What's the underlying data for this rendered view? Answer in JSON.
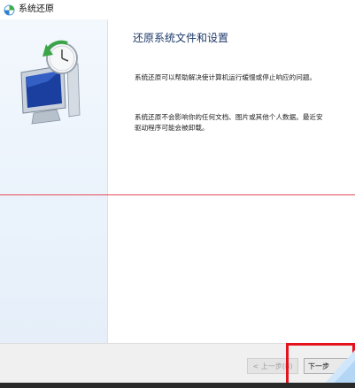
{
  "window": {
    "title": "系统还原",
    "title_icon": "system-restore-icon"
  },
  "main": {
    "heading": "还原系统文件和设置",
    "paragraph1": "系统还原可以帮助解决使计算机运行缓慢或停止响应的问题。",
    "paragraph2_lines": [
      "系统还原不会影响你的任何文档、图片或其他个人数据。最近安",
      "驱动程序可能会被卸载。"
    ]
  },
  "footer": {
    "back_label": "< 上一步(B)",
    "next_label": "下一步"
  },
  "colors": {
    "heading": "#1d3a6b",
    "sidebar": "#eaf2fb",
    "highlight": "#e3121c",
    "accent_line": "#e74a57"
  }
}
